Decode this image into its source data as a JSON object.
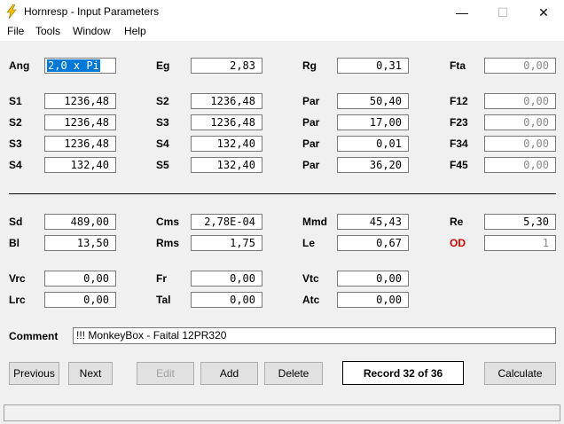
{
  "window": {
    "title": "Hornresp - Input Parameters",
    "minimize": "—",
    "maximize": "☐",
    "close": "✕"
  },
  "menu": [
    {
      "label": "File"
    },
    {
      "label": "Tools"
    },
    {
      "label": "Window"
    },
    {
      "label": "Help"
    }
  ],
  "params": {
    "ang": {
      "label": "Ang",
      "value": "2,0 x Pi"
    },
    "eg": {
      "label": "Eg",
      "value": "2,83"
    },
    "rg": {
      "label": "Rg",
      "value": "0,31"
    },
    "fta": {
      "label": "Fta",
      "value": "0,00"
    },
    "row1": {
      "s_a": "S1",
      "v_a": "1236,48",
      "s_b": "S2",
      "v_b": "1236,48",
      "par": "Par",
      "v_par": "50,40",
      "f": "F12",
      "v_f": "0,00"
    },
    "row2": {
      "s_a": "S2",
      "v_a": "1236,48",
      "s_b": "S3",
      "v_b": "1236,48",
      "par": "Par",
      "v_par": "17,00",
      "f": "F23",
      "v_f": "0,00"
    },
    "row3": {
      "s_a": "S3",
      "v_a": "1236,48",
      "s_b": "S4",
      "v_b": "132,40",
      "par": "Par",
      "v_par": "0,01",
      "f": "F34",
      "v_f": "0,00"
    },
    "row4": {
      "s_a": "S4",
      "v_a": "132,40",
      "s_b": "S5",
      "v_b": "132,40",
      "par": "Par",
      "v_par": "36,20",
      "f": "F45",
      "v_f": "0,00"
    }
  },
  "driver": {
    "sd": {
      "label": "Sd",
      "value": "489,00"
    },
    "cms": {
      "label": "Cms",
      "value": "2,78E-04"
    },
    "mmd": {
      "label": "Mmd",
      "value": "45,43"
    },
    "re": {
      "label": "Re",
      "value": "5,30"
    },
    "bl": {
      "label": "Bl",
      "value": "13,50"
    },
    "rms": {
      "label": "Rms",
      "value": "1,75"
    },
    "le": {
      "label": "Le",
      "value": "0,67"
    },
    "od": {
      "label": "OD",
      "value": "1"
    },
    "vrc": {
      "label": "Vrc",
      "value": "0,00"
    },
    "fr": {
      "label": "Fr",
      "value": "0,00"
    },
    "vtc": {
      "label": "Vtc",
      "value": "0,00"
    },
    "lrc": {
      "label": "Lrc",
      "value": "0,00"
    },
    "tal": {
      "label": "Tal",
      "value": "0,00"
    },
    "atc": {
      "label": "Atc",
      "value": "0,00"
    }
  },
  "comment": {
    "label": "Comment",
    "value": "!!! MonkeyBox - Faital 12PR320"
  },
  "buttons": {
    "previous": "Previous",
    "next": "Next",
    "edit": "Edit",
    "add": "Add",
    "delete": "Delete",
    "record": "Record 32 of 36",
    "calculate": "Calculate"
  }
}
